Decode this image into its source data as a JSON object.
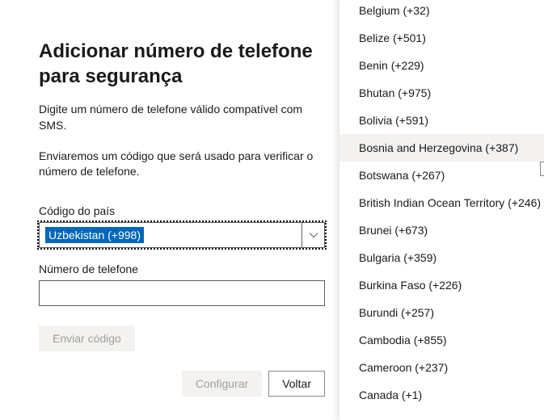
{
  "title": "Adicionar número de telefone para segurança",
  "desc": "Digite um número de telefone válido compatível com SMS.",
  "info": "Enviaremos um código que será usado para verificar o número de telefone.",
  "labels": {
    "country": "Código do país",
    "phone": "Número de telefone"
  },
  "selected_country": "Uzbekistan (+998)",
  "buttons": {
    "send": "Enviar código",
    "configure": "Configurar",
    "back": "Voltar"
  },
  "dropdown": {
    "hover_index": 5,
    "items": [
      "Belgium (+32)",
      "Belize (+501)",
      "Benin (+229)",
      "Bhutan (+975)",
      "Bolivia (+591)",
      "Bosnia and Herzegovina (+387)",
      "Botswana (+267)",
      "British Indian Ocean Territory (+246)",
      "Brunei (+673)",
      "Bulgaria (+359)",
      "Burkina Faso (+226)",
      "Burundi (+257)",
      "Cambodia (+855)",
      "Cameroon (+237)",
      "Canada (+1)"
    ]
  }
}
